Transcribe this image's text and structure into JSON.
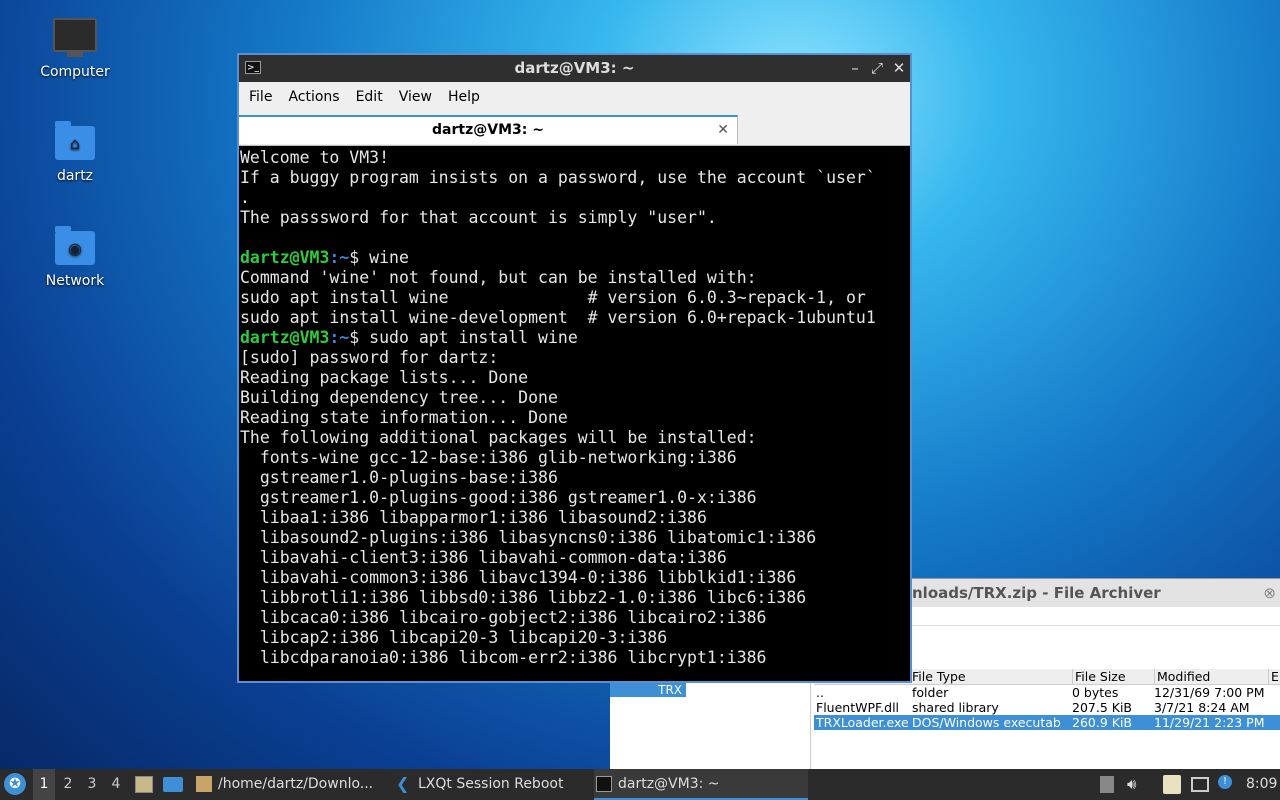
{
  "desktop": {
    "icons": [
      {
        "label": "Computer",
        "icon": "computer-icon"
      },
      {
        "label": "dartz",
        "icon": "home-folder-icon"
      },
      {
        "label": "Network",
        "icon": "network-folder-icon"
      }
    ]
  },
  "archiver": {
    "title": "nloads/TRX.zip - File Archiver",
    "tree_selected": "TRX",
    "columns": [
      "File Type",
      "File Size",
      "Modified",
      "En"
    ],
    "rows": [
      {
        "name": "..",
        "type": "folder",
        "size": "0 bytes",
        "modified": "12/31/69 7:00 PM"
      },
      {
        "name": "FluentWPF.dll",
        "type": "shared library",
        "size": "207.5 KiB",
        "modified": "3/7/21 8:24 AM"
      },
      {
        "name": "TRXLoader.exe",
        "type": "DOS/Windows executable",
        "size": "260.9 KiB",
        "modified": "11/29/21 2:23 PM"
      }
    ]
  },
  "terminal": {
    "title": "dartz@VM3: ~",
    "menu": [
      "File",
      "Actions",
      "Edit",
      "View",
      "Help"
    ],
    "tab_label": "dartz@VM3: ~",
    "prompt_user": "dartz@VM3",
    "prompt_path": ":~",
    "lines": [
      {
        "text": "Welcome to VM3!"
      },
      {
        "text": "If a buggy program insists on a password, use the account `user`"
      },
      {
        "text": "."
      },
      {
        "text": "The passsword for that account is simply \"user\"."
      },
      {
        "text": ""
      },
      {
        "prompt": true,
        "text": "$ wine"
      },
      {
        "text": "Command 'wine' not found, but can be installed with:"
      },
      {
        "text": "sudo apt install wine              # version 6.0.3~repack-1, or"
      },
      {
        "text": "sudo apt install wine-development  # version 6.0+repack-1ubuntu1"
      },
      {
        "prompt": true,
        "text": "$ sudo apt install wine"
      },
      {
        "text": "[sudo] password for dartz:"
      },
      {
        "text": "Reading package lists... Done"
      },
      {
        "text": "Building dependency tree... Done"
      },
      {
        "text": "Reading state information... Done"
      },
      {
        "text": "The following additional packages will be installed:"
      },
      {
        "text": "  fonts-wine gcc-12-base:i386 glib-networking:i386"
      },
      {
        "text": "  gstreamer1.0-plugins-base:i386"
      },
      {
        "text": "  gstreamer1.0-plugins-good:i386 gstreamer1.0-x:i386"
      },
      {
        "text": "  libaa1:i386 libapparmor1:i386 libasound2:i386"
      },
      {
        "text": "  libasound2-plugins:i386 libasyncns0:i386 libatomic1:i386"
      },
      {
        "text": "  libavahi-client3:i386 libavahi-common-data:i386"
      },
      {
        "text": "  libavahi-common3:i386 libavc1394-0:i386 libblkid1:i386"
      },
      {
        "text": "  libbrotli1:i386 libbsd0:i386 libbz2-1.0:i386 libc6:i386"
      },
      {
        "text": "  libcaca0:i386 libcairo-gobject2:i386 libcairo2:i386"
      },
      {
        "text": "  libcap2:i386 libcapi20-3 libcapi20-3:i386"
      },
      {
        "text": "  libcdparanoia0:i386 libcom-err2:i386 libcrypt1:i386"
      }
    ]
  },
  "taskbar": {
    "desktops": [
      "1",
      "2",
      "3",
      "4"
    ],
    "active_desktop": "1",
    "tasks": [
      {
        "label": "/home/dartz/Downlo...",
        "icon": "archive-icon"
      },
      {
        "label": "LXQt Session Reboot",
        "icon": "lxqt-icon"
      },
      {
        "label": "dartz@VM3: ~",
        "icon": "terminal-icon"
      }
    ],
    "clock": "8:09"
  }
}
